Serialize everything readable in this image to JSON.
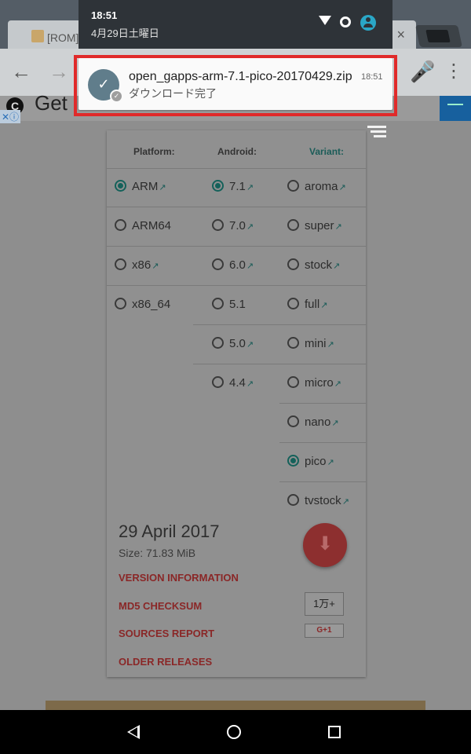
{
  "status_bar": {
    "time": "18:51",
    "date": "4月29日土曜日",
    "icons": [
      "wifi-icon",
      "sync-icon",
      "account-icon"
    ]
  },
  "browser": {
    "tab_title": "[ROM]",
    "tab_close": "×",
    "back_icon": "←",
    "forward_icon": "→",
    "mic_icon": "🎤",
    "menu_icon": "⋮"
  },
  "notification": {
    "title": "open_gapps-arm-7.1-pico-20170429.zip",
    "subtitle": "ダウンロード完了",
    "time": "18:51",
    "icon": "download-done-icon",
    "icon_glyph": "✓",
    "badge_glyph": "✓",
    "highlight_color": "#e02a2a"
  },
  "page": {
    "ad_text": "Get",
    "ad_logo": "C",
    "ad_close": "✕ⓘ",
    "headers": {
      "platform": "Platform:",
      "android": "Android:",
      "variant": "Variant:"
    },
    "platform": [
      {
        "label": "ARM",
        "selected": true,
        "ext": "↗"
      },
      {
        "label": "ARM64",
        "selected": false,
        "ext": ""
      },
      {
        "label": "x86",
        "selected": false,
        "ext": "↗"
      },
      {
        "label": "x86_64",
        "selected": false,
        "ext": ""
      }
    ],
    "android": [
      {
        "label": "7.1",
        "selected": true,
        "ext": "↗"
      },
      {
        "label": "7.0",
        "selected": false,
        "ext": "↗"
      },
      {
        "label": "6.0",
        "selected": false,
        "ext": "↗"
      },
      {
        "label": "5.1",
        "selected": false,
        "ext": ""
      },
      {
        "label": "5.0",
        "selected": false,
        "ext": "↗"
      },
      {
        "label": "4.4",
        "selected": false,
        "ext": "↗"
      }
    ],
    "variant": [
      {
        "label": "aroma",
        "selected": false,
        "ext": "↗"
      },
      {
        "label": "super",
        "selected": false,
        "ext": "↗"
      },
      {
        "label": "stock",
        "selected": false,
        "ext": "↗"
      },
      {
        "label": "full",
        "selected": false,
        "ext": "↗"
      },
      {
        "label": "mini",
        "selected": false,
        "ext": "↗"
      },
      {
        "label": "micro",
        "selected": false,
        "ext": "↗"
      },
      {
        "label": "nano",
        "selected": false,
        "ext": "↗"
      },
      {
        "label": "pico",
        "selected": true,
        "ext": "↗"
      },
      {
        "label": "tvstock",
        "selected": false,
        "ext": "↗"
      }
    ],
    "release_date": "29 April 2017",
    "release_size": "Size: 71.83 MiB",
    "links": {
      "version_info": "VERSION INFORMATION",
      "md5": "MD5 CHECKSUM",
      "sources": "SOURCES REPORT",
      "older": "OLDER RELEASES"
    },
    "download_icon": "⬇",
    "share_count": "1万+",
    "gplus": "G+1",
    "accent_color": "#14615a",
    "link_color": "#8a2727"
  },
  "navbar": {
    "icons": [
      "back-nav-icon",
      "home-nav-icon",
      "recents-nav-icon"
    ]
  }
}
